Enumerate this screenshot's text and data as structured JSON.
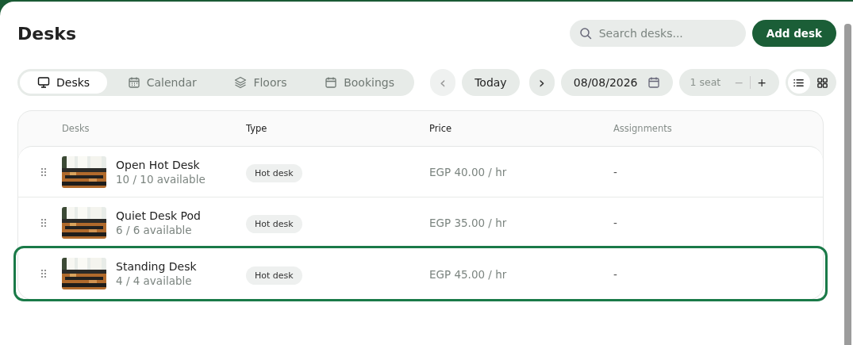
{
  "title": "Desks",
  "search": {
    "placeholder": "Search desks..."
  },
  "add_button": "Add desk",
  "tabs": [
    {
      "label": "Desks",
      "selected": true
    },
    {
      "label": "Calendar",
      "selected": false
    },
    {
      "label": "Floors",
      "selected": false
    },
    {
      "label": "Bookings",
      "selected": false
    }
  ],
  "date_nav": {
    "prev": "‹",
    "today": "Today",
    "next": "›",
    "date": "08/08/2026"
  },
  "seats": {
    "value": "1 seat",
    "minus": "−",
    "plus": "+"
  },
  "views": [
    {
      "kind": "list",
      "selected": true
    },
    {
      "kind": "grid",
      "selected": false
    }
  ],
  "table": {
    "columns": [
      {
        "label": "Desks",
        "highlighted": false
      },
      {
        "label": "Type",
        "highlighted": true
      },
      {
        "label": "Price",
        "highlighted": true
      },
      {
        "label": "Assignments",
        "highlighted": false
      }
    ],
    "rows": [
      {
        "name": "Open Hot Desk",
        "availability": "10 / 10 available",
        "type": "Hot desk",
        "price": "EGP 40.00 / hr",
        "assignments": "-",
        "selected": false
      },
      {
        "name": "Quiet Desk Pod",
        "availability": "6 / 6 available",
        "type": "Hot desk",
        "price": "EGP 35.00 / hr",
        "assignments": "-",
        "selected": false
      },
      {
        "name": "Standing Desk",
        "availability": "4 / 4 available",
        "type": "Hot desk",
        "price": "EGP 45.00 / hr",
        "assignments": "-",
        "selected": true
      }
    ]
  }
}
